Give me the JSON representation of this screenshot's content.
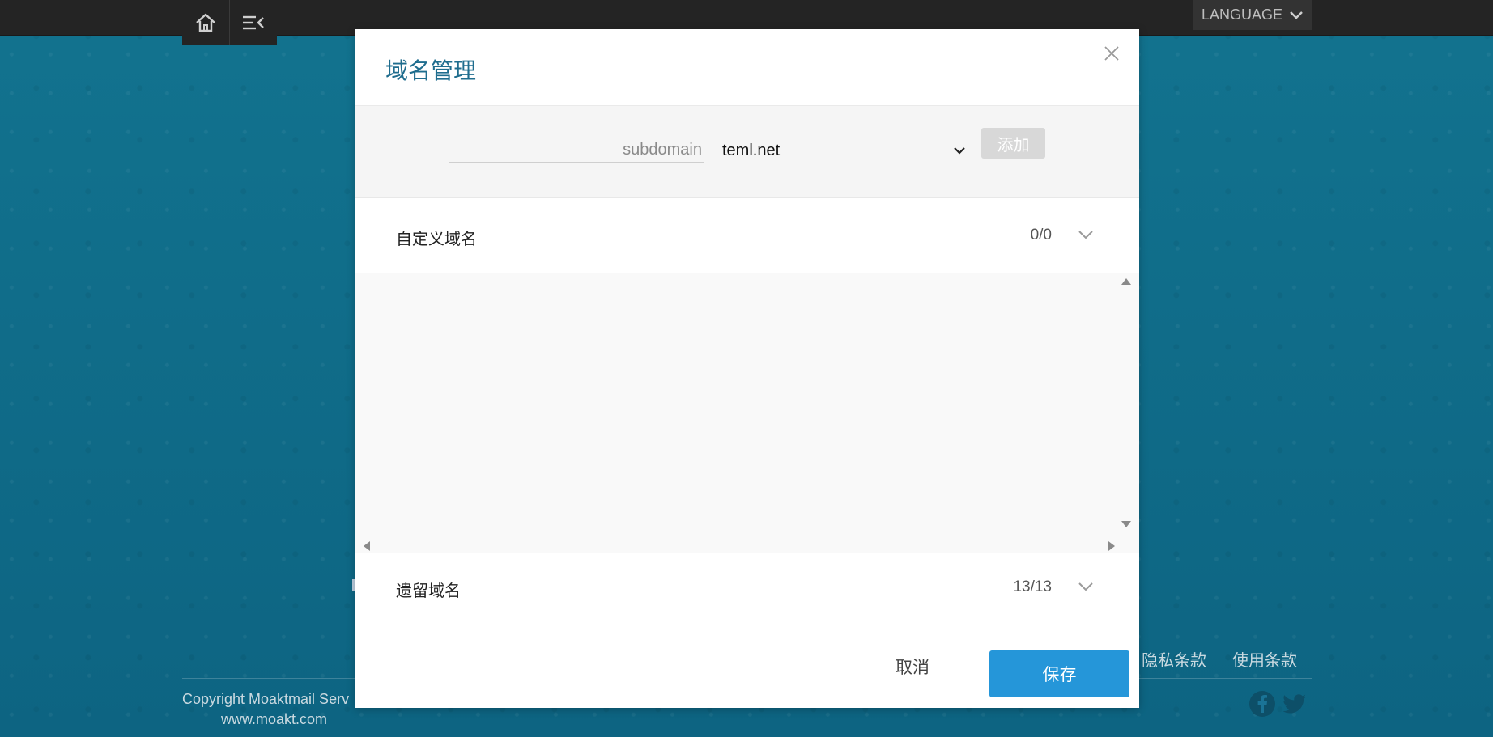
{
  "topbar": {
    "language_label": "LANGUAGE"
  },
  "footer": {
    "links": [
      "隐私条款",
      "使用条款"
    ],
    "copyright": "Copyright Moaktmail Serv",
    "site": "www.moakt.com"
  },
  "modal": {
    "title": "域名管理",
    "subdomain_placeholder": "subdomain",
    "subdomain_value": "",
    "domain_selected": "teml.net",
    "add_label": "添加",
    "custom_section": {
      "label": "自定义域名",
      "count": "0/0"
    },
    "reserved_section": {
      "label": "遗留域名",
      "count": "13/13"
    },
    "cancel_label": "取消",
    "save_label": "保存"
  },
  "colors": {
    "accent": "#2596d9",
    "title": "#1f6d8e",
    "background": "#0f6d8c",
    "topbar": "#242424"
  }
}
